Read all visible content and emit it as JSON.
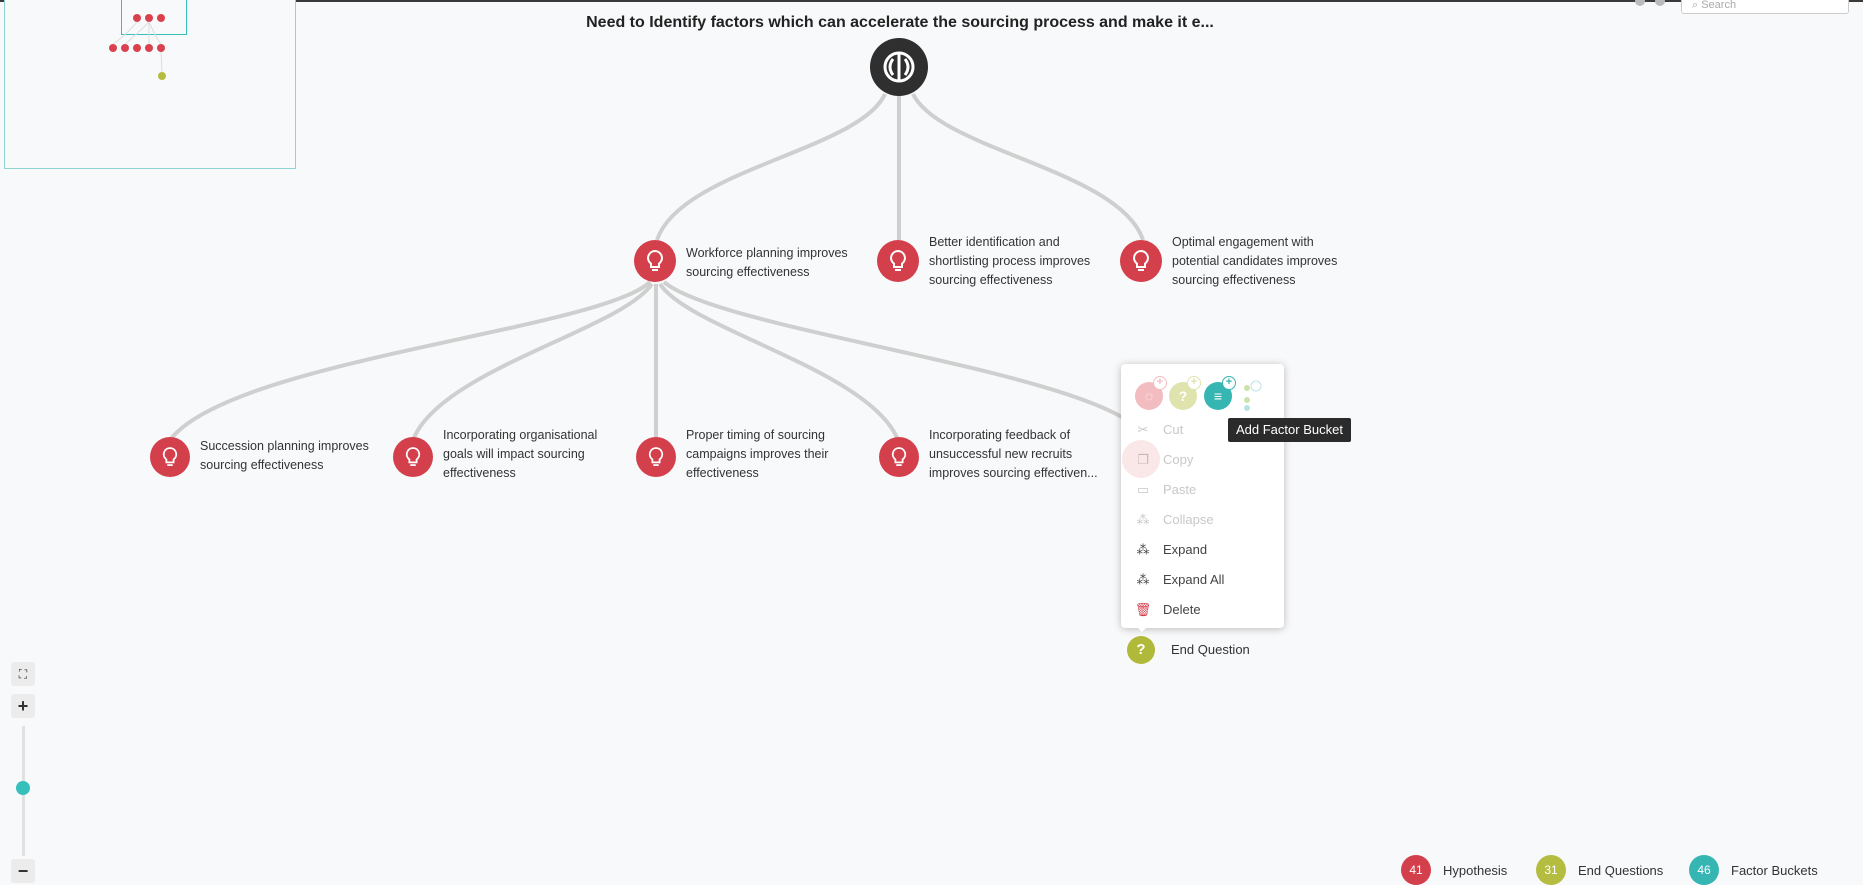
{
  "title": "Need to Identify factors which can accelerate the sourcing process and make it e...",
  "search": {
    "placeholder": "Search"
  },
  "hypotheses_level1": [
    {
      "label": "Workforce planning improves sourcing effectiveness"
    },
    {
      "label": "Better identification and shortlisting process improves sourcing effectiveness"
    },
    {
      "label": "Optimal engagement with potential candidates improves sourcing effectiveness"
    }
  ],
  "hypotheses_level2": [
    {
      "label": "Succession planning improves sourcing effectiveness"
    },
    {
      "label": "Incorporating organisational goals will impact sourcing effectiveness"
    },
    {
      "label": "Proper timing of sourcing campaigns improves their effectiveness"
    },
    {
      "label": "Incorporating feedback of unsuccessful new recruits improves sourcing effectiven..."
    }
  ],
  "context_menu": {
    "items": [
      {
        "label": "Cut",
        "enabled": false,
        "icon": "scissors-icon"
      },
      {
        "label": "Copy",
        "enabled": false,
        "icon": "copy-icon"
      },
      {
        "label": "Paste",
        "enabled": false,
        "icon": "paste-icon"
      },
      {
        "label": "Collapse",
        "enabled": false,
        "icon": "collapse-icon"
      },
      {
        "label": "Expand",
        "enabled": true,
        "icon": "expand-icon"
      },
      {
        "label": "Expand All",
        "enabled": true,
        "icon": "expand-all-icon"
      },
      {
        "label": "Delete",
        "enabled": true,
        "icon": "trash-icon"
      }
    ],
    "quick_add": [
      "add-hypothesis-icon",
      "add-end-question-icon",
      "add-factor-bucket-icon",
      "add-child-icon"
    ]
  },
  "tooltip": "Add Factor Bucket",
  "end_question": {
    "label": "End Question",
    "symbol": "?"
  },
  "legend": [
    {
      "count": "41",
      "label": "Hypothesis",
      "color": "#d43f4c"
    },
    {
      "count": "31",
      "label": "End Questions",
      "color": "#b4bd3f"
    },
    {
      "count": "46",
      "label": "Factor Buckets",
      "color": "#36b6b3"
    }
  ],
  "zoom": {
    "in_label": "+",
    "out_label": "−",
    "level": 0.52
  },
  "colors": {
    "hypothesis": "#d43f4c",
    "end_question": "#b1b93a",
    "factor_bucket": "#36b6b3",
    "root": "#2f2f2f"
  }
}
